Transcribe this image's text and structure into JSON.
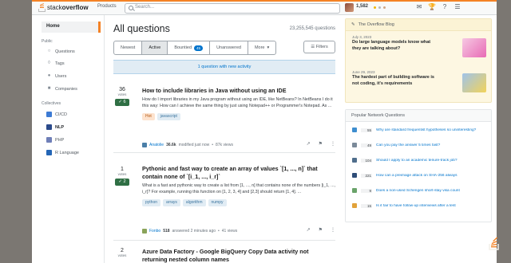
{
  "colors": {
    "accent": "#f48225",
    "link": "#0074cc",
    "answered": "#2f6f44"
  },
  "topbar": {
    "logo_light": "stack",
    "logo_bold": "overflow",
    "products": "Products",
    "search_placeholder": "Search...",
    "reputation": "1,582",
    "badge_dots": [
      "#f1b600",
      "#b4b8bc",
      "#d1a684"
    ]
  },
  "nav": {
    "home": "Home",
    "public_heading": "Public",
    "items": [
      "Questions",
      "Tags",
      "Users",
      "Companies"
    ],
    "collectives_heading": "Collectives",
    "collectives": [
      {
        "label": "CI/CD",
        "color": "#3d7bd4"
      },
      {
        "label": "NLP",
        "color": "#2b4a8b"
      },
      {
        "label": "PHP",
        "color": "#6f7fb8"
      },
      {
        "label": "R Language",
        "color": "#2466b6"
      }
    ]
  },
  "main": {
    "title": "All questions",
    "count": "23,255,545 questions",
    "tabs": [
      "Newest",
      "Active",
      "Bountied",
      "Unanswered",
      "More"
    ],
    "bountied_count": "45",
    "filters": "Filters",
    "banner": "1 question with new activity"
  },
  "questions": [
    {
      "votes": "36",
      "votes_label": "votes",
      "answers": "6",
      "title": "How to include libraries in Java without using an IDE",
      "excerpt": "How do I import libraries in my Java program without using an IDE, like NetBeans? In NetBeans I do it this way: How can I achieve the same thing by just using Notepad++ or Programmer's Notepad. As ...",
      "tags": [
        "Hot",
        "javascript"
      ],
      "user": "Anatolie",
      "rep": "36.6k",
      "time": "modified just now",
      "views": "87k views"
    },
    {
      "votes": "1",
      "votes_label": "votes",
      "answers": "2",
      "title": "Pythonic and fast way to create an array of values `[1, ..., n]` that contain none of `[i_1, ..., i_r]`",
      "excerpt": "What is a fast and pythonic way to create a list from [1, ..., n] that contains none of the numbers [i_1, ..., i_r]? For example, running this function on [1, 2, 3, 4] and [2,3] should return [1, 4]. ...",
      "tags": [
        "python",
        "arrays",
        "algorithm",
        "numpy"
      ],
      "user": "Fonbo",
      "rep": "518",
      "time": "answered 2 minutes ago",
      "views": "41 views"
    },
    {
      "votes": "2",
      "votes_label": "votes",
      "title": "Azure Data Factory - Google BigQuery Copy Data activity not returning nested column names"
    }
  ],
  "sidebar": {
    "blog_heading": "The Overflow Blog",
    "blog": [
      {
        "date": "July 3, 2023",
        "title": "Do large language models know what they are talking about?"
      },
      {
        "date": "June 29, 2023",
        "title": "The hardest part of building software is not coding, it's requirements"
      }
    ],
    "network_heading": "Popular Network Questions",
    "network": [
      {
        "num": "55",
        "title": "Why are standard frequentist hypotheses so uninteresting?",
        "color": "#3e8ecf"
      },
      {
        "num": "49",
        "title": "Can you pay the answer 5 times fast?",
        "color": "#7b8a99"
      },
      {
        "num": "104",
        "title": "Should I apply to an academic tenure-track job?",
        "color": "#4f6e8c"
      },
      {
        "num": "221",
        "title": "How can a preimage attack on SHA-256 always",
        "color": "#2f4d78"
      },
      {
        "num": "9",
        "title": "Does a non-used Schengen short-stay visa count",
        "color": "#6aa36a"
      },
      {
        "num": "15",
        "title": "Is it fair to have follow-up interviews after a test",
        "color": "#e1a23a"
      }
    ]
  }
}
